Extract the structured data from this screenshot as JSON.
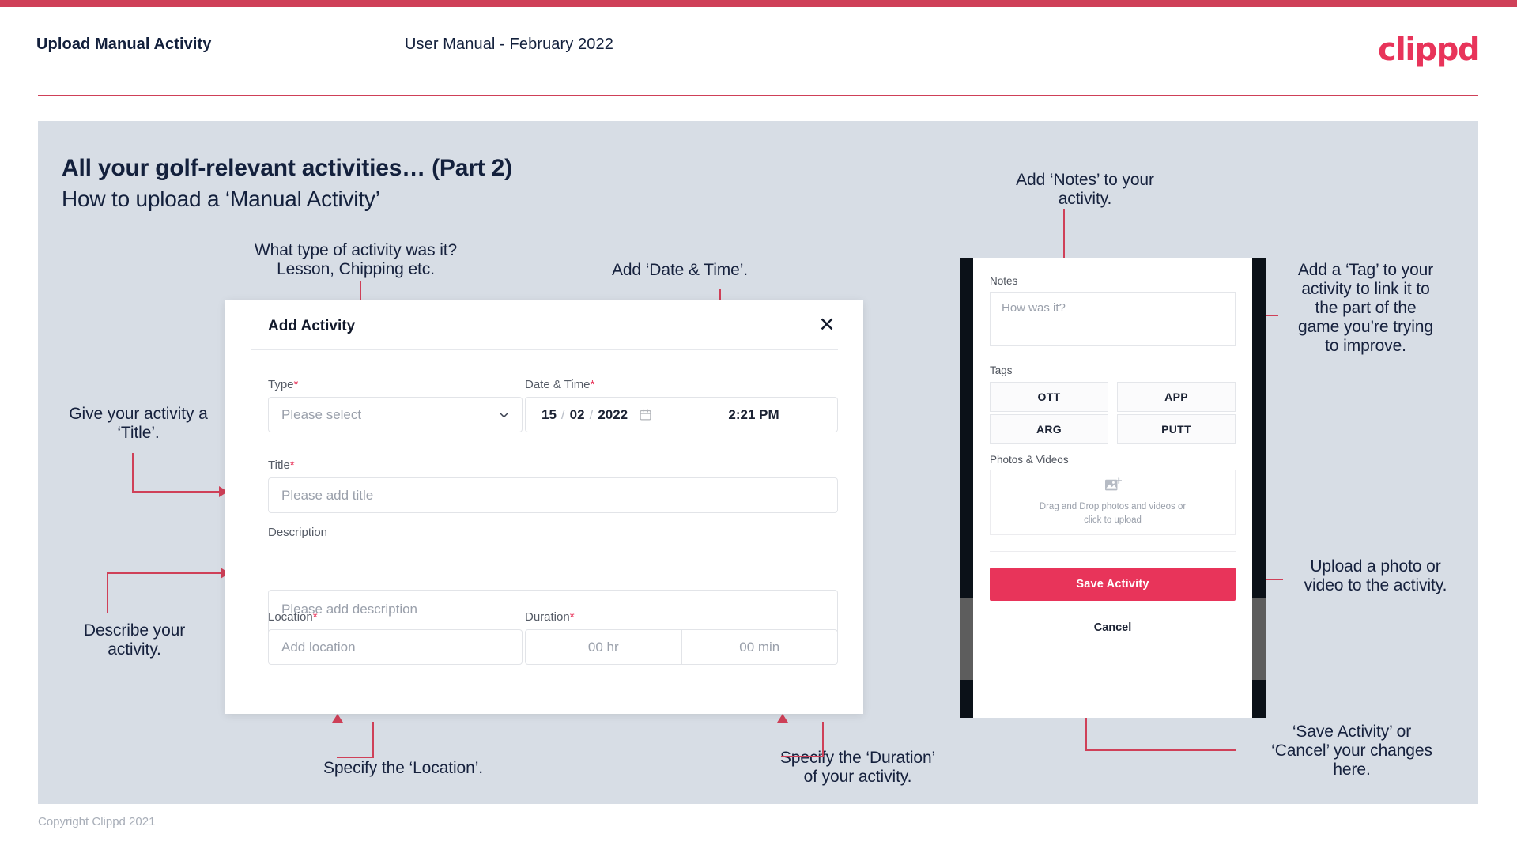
{
  "header": {
    "title": "Upload Manual Activity",
    "subtitle": "User Manual - February 2022",
    "logo": "clippd"
  },
  "slide": {
    "title": "All your golf-relevant activities… (Part 2)",
    "subtitle": "How to upload a ‘Manual Activity’"
  },
  "dialog": {
    "title": "Add Activity",
    "close_icon": "close-icon",
    "fields": {
      "type": {
        "label": "Type",
        "required": "*",
        "placeholder": "Please select"
      },
      "datetime": {
        "label": "Date & Time",
        "required": "*",
        "day": "15",
        "month": "02",
        "year": "2022",
        "sep": "/",
        "time": "2:21 PM"
      },
      "title": {
        "label": "Title",
        "required": "*",
        "placeholder": "Please add title"
      },
      "description": {
        "label": "Description",
        "placeholder": "Please add description"
      },
      "location": {
        "label": "Location",
        "required": "*",
        "placeholder": "Add location"
      },
      "duration": {
        "label": "Duration",
        "required": "*",
        "hours": "00 hr",
        "minutes": "00 min"
      }
    }
  },
  "phone": {
    "notes": {
      "label": "Notes",
      "placeholder": "How was it?"
    },
    "tags": {
      "label": "Tags",
      "items": [
        "OTT",
        "APP",
        "ARG",
        "PUTT"
      ]
    },
    "photos": {
      "label": "Photos & Videos",
      "dropzone_line1": "Drag and Drop photos and videos or",
      "dropzone_line2": "click to upload"
    },
    "save_label": "Save Activity",
    "cancel_label": "Cancel"
  },
  "annotations": {
    "type": "What type of activity was it?\nLesson, Chipping etc.",
    "datetime": "Add ‘Date & Time’.",
    "title": "Give your activity a\n‘Title’.",
    "description": "Describe your\nactivity.",
    "location": "Specify the ‘Location’.",
    "duration": "Specify the ‘Duration’\nof your activity.",
    "notes": "Add ‘Notes’ to your\nactivity.",
    "tags": "Add a ‘Tag’ to your\nactivity to link it to\nthe part of the\ngame you’re trying\nto improve.",
    "upload": "Upload a photo or\nvideo to the activity.",
    "savecancel": "‘Save Activity’ or\n‘Cancel’ your changes\nhere."
  },
  "footer": {
    "copyright": "Copyright Clippd 2021"
  },
  "colors": {
    "accent": "#cf4058",
    "brand": "#e8345a",
    "slide_bg": "#d7dde5",
    "text_dark": "#13203c"
  }
}
